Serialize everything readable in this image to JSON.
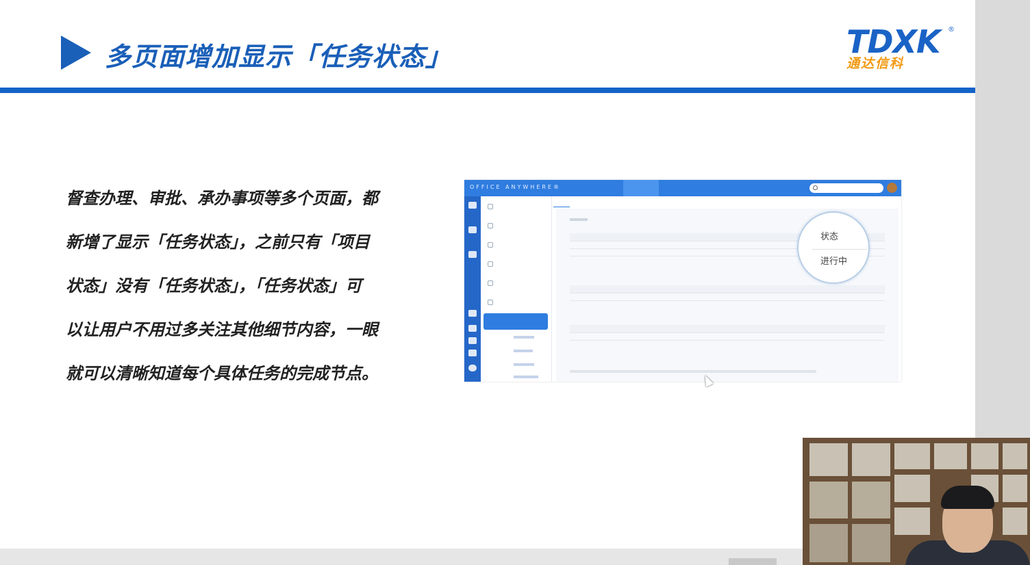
{
  "slide": {
    "title": "多页面增加显示「任务状态」",
    "logo": {
      "mark": "TDXK",
      "reg": "®",
      "sub": "通达信科"
    },
    "paragraph_lines": [
      "督查办理、审批、承办事项等多个页面，都",
      "新增了显示「任务状态」，之前只有「项目",
      "状态」没有「任务状态」，「任务状态」可",
      "以让用户不用过多关注其他细节内容，一眼",
      "就可以清晰知道每个具体任务的完成节点。"
    ]
  },
  "screenshot": {
    "brand": "OFFICE ANYWHERE®",
    "zoom_callout": {
      "header": "状态",
      "value": "进行中"
    }
  },
  "colors": {
    "accent_blue": "#1a5fb8",
    "header_bar": "#1463c8",
    "logo_orange": "#f19a14",
    "app_top": "#2f7de0"
  }
}
